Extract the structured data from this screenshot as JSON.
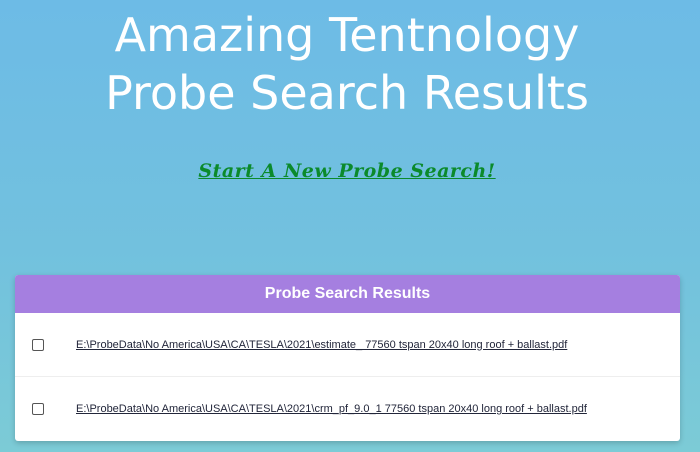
{
  "header": {
    "title_line1": "Amazing Tentnology",
    "title_line2": "Probe Search Results",
    "new_search_link": "Start A New Probe Search!"
  },
  "results_panel": {
    "heading": "Probe Search Results",
    "rows": [
      {
        "checked": false,
        "path": "E:\\ProbeData\\No America\\USA\\CA\\TESLA\\2021\\estimate_ 77560 tspan 20x40 long roof + ballast.pdf"
      },
      {
        "checked": false,
        "path": "E:\\ProbeData\\No America\\USA\\CA\\TESLA\\2021\\crm_pf_9.0_1 77560 tspan 20x40 long roof + ballast.pdf"
      }
    ]
  },
  "colors": {
    "background_top": "#6dbbe6",
    "background_bottom": "#7ccbd6",
    "header_bar": "#a57fe0",
    "link_green": "#0b8a2b"
  }
}
